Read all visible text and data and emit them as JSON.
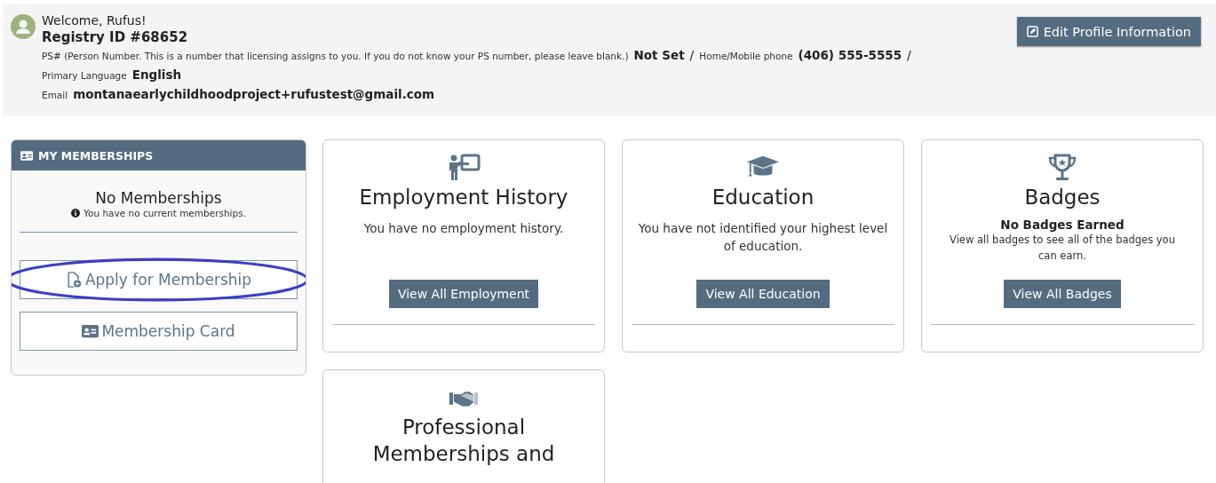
{
  "profile": {
    "welcome": "Welcome, Rufus!",
    "registry_id": "Registry ID  #68652",
    "fields": [
      {
        "label": "PS# (Person Number. This is a number that licensing assigns to you. If you do not know your PS number, please leave blank.)",
        "value": "Not Set",
        "separator": "/"
      },
      {
        "label": "Home/Mobile phone",
        "value": "(406) 555-5555",
        "separator": "/"
      },
      {
        "label": "Primary Language",
        "value": "English"
      },
      {
        "label": "Email",
        "value": "montanaearlychildhoodproject+rufustest@gmail.com"
      }
    ],
    "edit_button": "Edit Profile Information"
  },
  "memberships": {
    "title": "MY MEMBERSHIPS",
    "status": "No Memberships",
    "note": "You have no current memberships.",
    "buttons": [
      {
        "label": "Apply for Membership",
        "kind": "apply",
        "circled": true
      },
      {
        "label": "Membership Card",
        "kind": "card",
        "circled": false
      }
    ]
  },
  "cards": [
    {
      "kind": "employment",
      "title": "Employment History",
      "text": "You have no employment history.",
      "button": "View All Employment"
    },
    {
      "kind": "education",
      "title": "Education",
      "text": "You have not identified your highest level of education.",
      "button": "View All Education"
    },
    {
      "kind": "badges",
      "title": "Badges",
      "subtitle": "No Badges Earned",
      "text": "View all badges to see all of the badges you can earn.",
      "button": "View All Badges"
    },
    {
      "kind": "professional",
      "title": "Professional Memberships and"
    }
  ]
}
